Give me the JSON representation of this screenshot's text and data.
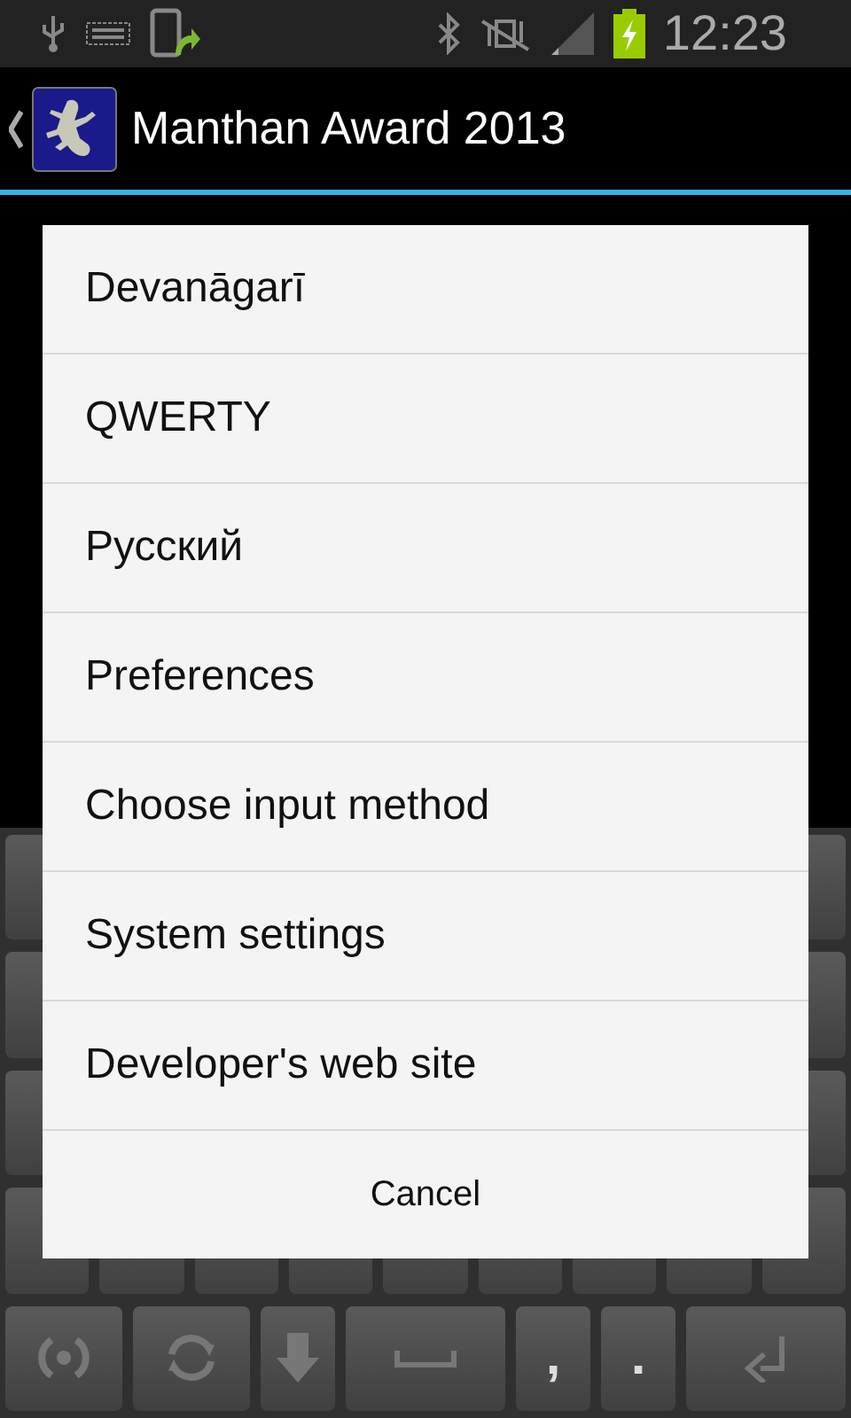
{
  "status_bar": {
    "time": "12:23"
  },
  "action_bar": {
    "title": "Manthan Award 2013"
  },
  "dialog": {
    "items": [
      {
        "label": "Devanāgarī"
      },
      {
        "label": "QWERTY"
      },
      {
        "label": "Русский"
      },
      {
        "label": "Preferences"
      },
      {
        "label": "Choose input method"
      },
      {
        "label": "System settings"
      },
      {
        "label": "Developer's web site"
      }
    ],
    "cancel": "Cancel"
  },
  "keyboard": {
    "bottom_row": [
      {
        "kind": "voice"
      },
      {
        "kind": "sync"
      },
      {
        "kind": "hide"
      },
      {
        "kind": "space"
      },
      {
        "kind": "char",
        "label": ","
      },
      {
        "kind": "char",
        "label": "."
      },
      {
        "kind": "enter"
      }
    ]
  }
}
